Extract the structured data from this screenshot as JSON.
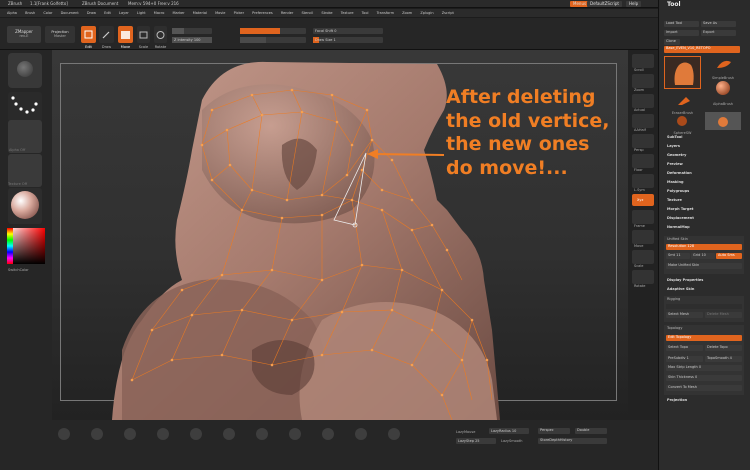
{
  "titlebar": {
    "app": "ZBrush",
    "doc": "1.1[Frank Golfetto]",
    "document": "ZBrush Document",
    "stats": "Mem:v 594+0 Free:v 216",
    "menus_btn": "Menus",
    "script_btn": "DefaultZScript",
    "help_btn": "Help"
  },
  "menubar": [
    "Alpha",
    "Brush",
    "Color",
    "Document",
    "Draw",
    "Edit",
    "Layer",
    "Light",
    "Macro",
    "Marker",
    "Material",
    "Movie",
    "Picker",
    "Preferences",
    "Render",
    "Stencil",
    "Stroke",
    "Texture",
    "Tool",
    "Transform",
    "Zoom",
    "Zplugin",
    "Zscript"
  ],
  "toolbar": {
    "zmapper": "ZMapper",
    "zmapper_sub": "rev-E",
    "projection": "Projection",
    "projection_sub": "Master",
    "edit": "Edit",
    "draw": "Draw",
    "move": "Move",
    "scale": "Scale",
    "rotate": "Rotate",
    "focal_shift": "Focal Shift 0",
    "draw_size": "Draw Size 1",
    "z_intensity": "Z Intensity 100"
  },
  "left_shelf": {
    "alpha_label": "Alpha Off",
    "texture_label": "Texture Off",
    "color_label": "SwitchColor"
  },
  "right_shelf": [
    "Scroll",
    "Zoom",
    "Actual",
    "AAHalf",
    "Persp",
    "Floor",
    "L.Sym",
    "Xyz",
    "Frame",
    "Move",
    "Scale",
    "Rotate",
    "Transp",
    "Ghost",
    "Solo"
  ],
  "bottom_bar": {
    "lazymouse": "LazyMouse",
    "lazyradius": "LazyRadius 10",
    "lazystep": "LazyStep 25",
    "lazysmooth": "LazySmooth",
    "perspective": "Perspec",
    "double": "Double",
    "store_depth": "StoreDepthHistory"
  },
  "tray": {
    "title": "Tool",
    "load_tool": "Load Tool",
    "save_as": "Save As",
    "import": "Import",
    "export": "Export",
    "clone": "Clone",
    "tool_name": "Base_EVEN_V10_RETOPO",
    "thumbs": [
      "",
      "SimpleBrush",
      "",
      "EraserBrush",
      "AlphaBrush",
      "SphereSW",
      "Sphere3D",
      "ZBrushDB"
    ],
    "sections": [
      "SubTool",
      "Layers",
      "Geometry",
      "Preview",
      "Deformation",
      "Masking",
      "Polygroups",
      "Texture",
      "Morph Target",
      "Displacement",
      "NormalMap"
    ],
    "unified_skin": "Unified Skin",
    "resolution": "Resolution 128",
    "smt": "Smt 11",
    "grid": "Grid 10",
    "auto_sms": "Auto Sms",
    "make_unified": "Make Unified Skin",
    "display_props": "Display Properties",
    "adaptive_skin": "Adaptive Skin",
    "rigging": "Rigging",
    "select_mesh": "Select Mesh",
    "delete_mesh": "Delete Mesh",
    "topology": "Topology",
    "edit_topology": "Edit Topology",
    "select_topo": "Select Topo",
    "delete_topo": "Delete Topo",
    "preSubdiv": "PreSubdiv 1",
    "topo_smooth": "TopoSmooth 4",
    "strip_length": "Max Strip Length 0",
    "skin_thickness": "Skin Thickness 0",
    "convert_mesh": "Convert To Mesh",
    "projection": "Projection"
  },
  "annotation": [
    "After deleting",
    "the old vertice,",
    "the new ones",
    "do move!..."
  ],
  "colors": {
    "accent": "#e0641e",
    "annotation": "#f07e24",
    "topology": "#f07b1e"
  }
}
